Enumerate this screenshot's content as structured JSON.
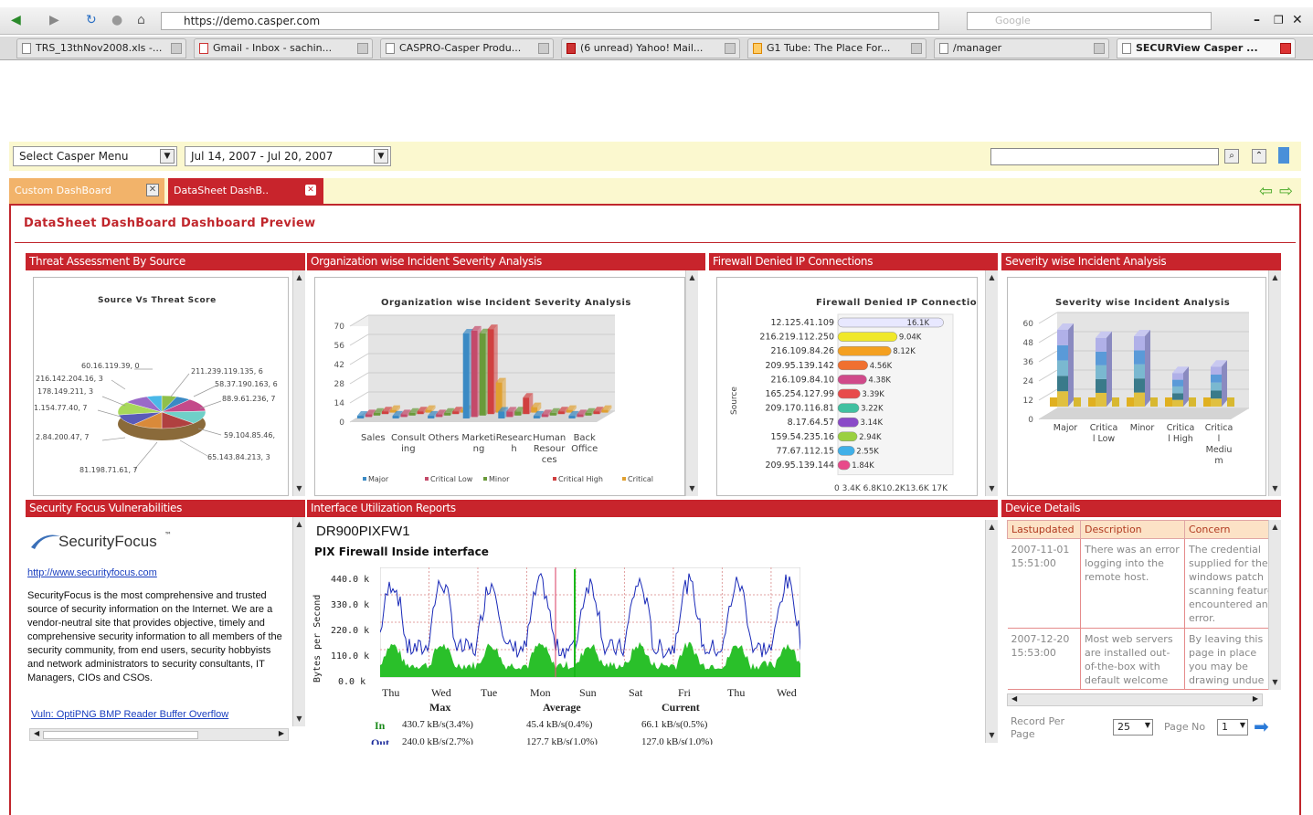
{
  "browser": {
    "url": "https://demo.casper.com",
    "search_placeholder": "Google",
    "tabs": [
      {
        "label": "TRS_13thNov2008.xls -..."
      },
      {
        "label": "Gmail - Inbox - sachin..."
      },
      {
        "label": "CASPRO-Casper Produ..."
      },
      {
        "label": "(6 unread) Yahoo! Mail..."
      },
      {
        "label": "G1 Tube: The Place For..."
      },
      {
        "label": "/manager"
      },
      {
        "label": "SECURView Casper ..."
      }
    ]
  },
  "toolbar": {
    "menu_select": "Select Casper Menu",
    "date_range": "Jul 14, 2007 - Jul 20, 2007"
  },
  "dash_tabs": [
    {
      "label": "Custom DashBoard"
    },
    {
      "label": "DataSheet DashB.."
    }
  ],
  "page": {
    "title": "DataSheet DashBoard Dashboard Preview"
  },
  "panels": {
    "threat": {
      "title": "Threat Assessment By Source",
      "chart_title": "Source Vs Threat Score",
      "labels": [
        "60.16.119.39, 0",
        "216.142.204.16, 3",
        "178.149.211, 3",
        "1.154.77.40, 7",
        "2.84.200.47, 7",
        "81.198.71.61, 7",
        "211.239.119.135, 6",
        "58.37.190.163, 6",
        "88.9.61.236, 7",
        "59.104.85.46,",
        "65.143.84.213, 3"
      ]
    },
    "org": {
      "title": "Organization wise Incident Severity Analysis",
      "chart_title": "Organization wise Incident Severity Analysis"
    },
    "firewall": {
      "title": "Firewall Denied IP Connections",
      "chart_title": "Firewall Denied IP Connectio",
      "ylabel": "Source",
      "xticks": "0  3.4K 6.8K10.2K13.6K 17K"
    },
    "severity": {
      "title": "Severity wise Incident Analysis",
      "chart_title": "Severity wise Incident Analysis"
    },
    "secfocus": {
      "title": "Security Focus Vulnerabilities",
      "logo": "SecurityFocus",
      "link": "http://www.securityfocus.com",
      "desc": "SecurityFocus is the most comprehensive and trusted source of security information on the Internet. We are a vendor-neutral site that provides objective, timely and comprehensive security information to all members of the security community, from end users, security hobbyists and network administrators to security consultants, IT Managers, CIOs and CSOs.",
      "vuln": "Vuln: OptiPNG BMP Reader Buffer Overflow Vulnerability"
    },
    "iface": {
      "title": "Interface Utilization Reports",
      "device": "DR900PIXFW1",
      "subtitle": "PIX Firewall Inside interface",
      "ylabel": "Bytes per Second",
      "yticks": [
        "440.0 k",
        "330.0 k",
        "220.0 k",
        "110.0 k",
        "0.0 k"
      ],
      "days": [
        "Thu",
        "Wed",
        "Tue",
        "Mon",
        "Sun",
        "Sat",
        "Fri",
        "Thu",
        "Wed"
      ],
      "stats_headers": [
        "Max",
        "Average",
        "Current"
      ],
      "in_label": "In",
      "in_values": [
        "430.7 kB/s(3.4%)",
        "45.4 kB/s(0.4%)",
        "66.1 kB/s(0.5%)"
      ],
      "out_label": "Out",
      "out_values": [
        "240.0 kB/s(2.7%)",
        "127.7 kB/s(1.0%)",
        "127.0 kB/s(1.0%)"
      ]
    },
    "device": {
      "title": "Device Details",
      "columns": [
        "Lastupdated",
        "Description",
        "Concern"
      ],
      "rows": [
        {
          "date": "2007-11-01 15:51:00",
          "desc": "There was an error logging into the remote host.",
          "concern": "The credential supplied for the windows patch scanning feature encountered an error."
        },
        {
          "date": "2007-12-20 15:53:00",
          "desc": "Most web servers are installed out-of-the-box with default welcome pages. The",
          "concern": "By leaving this page in place you may be drawing undue attention to this"
        }
      ],
      "record_label": "Record Per Page",
      "record_value": "25",
      "page_label": "Page No",
      "page_value": "1"
    }
  },
  "chart_data": [
    {
      "type": "pie",
      "title": "Source Vs Threat Score",
      "categories": [
        "60.16.119.39",
        "216.142.204.16",
        "178.149.211",
        "1.154.77.40",
        "2.84.200.47",
        "81.198.71.61",
        "211.239.119.135",
        "58.37.190.163",
        "88.9.61.236",
        "59.104.85.46",
        "65.143.84.213"
      ],
      "values": [
        0,
        3,
        3,
        7,
        7,
        7,
        6,
        6,
        7,
        5,
        3
      ]
    },
    {
      "type": "bar",
      "title": "Organization wise Incident Severity Analysis",
      "categories": [
        "Sales",
        "Consulting",
        "Others",
        "Marketing",
        "Research",
        "Human Resources",
        "Back Office"
      ],
      "ylim": [
        0,
        70
      ],
      "series": [
        {
          "name": "Major",
          "values": [
            2,
            2,
            2,
            62,
            5,
            2,
            2
          ]
        },
        {
          "name": "Critical Low",
          "values": [
            2,
            2,
            2,
            63,
            4,
            2,
            2
          ]
        },
        {
          "name": "Minor",
          "values": [
            2,
            2,
            2,
            60,
            3,
            2,
            2
          ]
        },
        {
          "name": "Critical High",
          "values": [
            2,
            2,
            2,
            62,
            12,
            2,
            2
          ]
        },
        {
          "name": "Critical",
          "values": [
            2,
            2,
            2,
            22,
            4,
            2,
            2
          ]
        }
      ]
    },
    {
      "type": "bar",
      "title": "Firewall Denied IP Connectio",
      "xlabel": "",
      "ylabel": "Source",
      "categories": [
        "12.125.41.109",
        "216.219.112.250",
        "216.109.84.26",
        "209.95.139.142",
        "216.109.84.10",
        "165.254.127.99",
        "209.170.116.81",
        "8.17.64.57",
        "159.54.235.16",
        "77.67.112.15",
        "209.95.139.144"
      ],
      "values": [
        16.1,
        9.04,
        8.12,
        4.56,
        4.38,
        3.39,
        3.22,
        3.14,
        2.94,
        2.55,
        1.84
      ],
      "value_labels": [
        "16.1K",
        "9.04K",
        "8.12K",
        "4.56K",
        "4.38K",
        "3.39K",
        "3.22K",
        "3.14K",
        "2.94K",
        "2.55K",
        "1.84K"
      ],
      "xlim": [
        0,
        17
      ]
    },
    {
      "type": "bar",
      "title": "Severity wise Incident Analysis",
      "categories": [
        "Major",
        "Critical Low",
        "Minor",
        "Critical High",
        "Critical Medium"
      ],
      "ylim": [
        0,
        60
      ],
      "values": [
        48,
        43,
        44,
        21,
        25
      ]
    }
  ]
}
